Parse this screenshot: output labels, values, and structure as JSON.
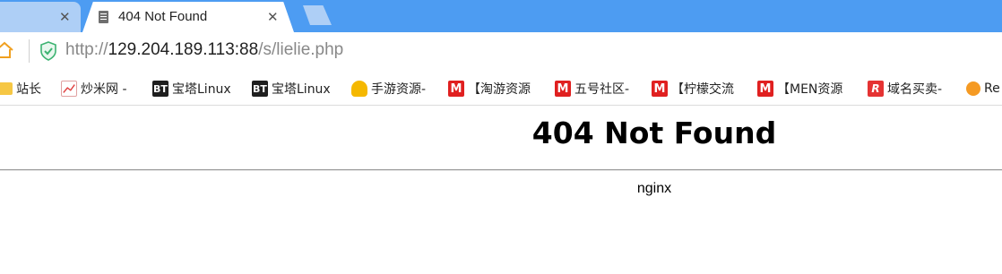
{
  "tabs": [
    {
      "title": "",
      "active": false
    },
    {
      "title": "404 Not Found",
      "active": true
    }
  ],
  "address": {
    "scheme": "http://",
    "host": "129.204.189.113:88",
    "path": "/s/lielie.php"
  },
  "bookmarks": [
    {
      "label": "站长",
      "icon": "folder-icon"
    },
    {
      "label": "炒米网 -",
      "icon": "chart-icon"
    },
    {
      "label": "宝塔Linux",
      "icon": "bt-icon",
      "icon_text": "BT"
    },
    {
      "label": "宝塔Linux",
      "icon": "bt-icon",
      "icon_text": "BT"
    },
    {
      "label": "手游资源-",
      "icon": "trophy-icon"
    },
    {
      "label": "【淘游资源",
      "icon": "m-icon",
      "icon_text": "M"
    },
    {
      "label": "五号社区-",
      "icon": "m-icon",
      "icon_text": "M"
    },
    {
      "label": "【柠檬交流",
      "icon": "m-icon",
      "icon_text": "M"
    },
    {
      "label": "【MEN资源",
      "icon": "m-icon",
      "icon_text": "M"
    },
    {
      "label": "域名买卖-",
      "icon": "domain-icon",
      "icon_text": "R"
    },
    {
      "label": "Re",
      "icon": "re-icon"
    }
  ],
  "page": {
    "heading": "404 Not Found",
    "server": "nginx"
  },
  "colors": {
    "tabstrip": "#4d9cf2",
    "inactive_tab": "#aecff6",
    "secure_shield": "#3cb371"
  }
}
